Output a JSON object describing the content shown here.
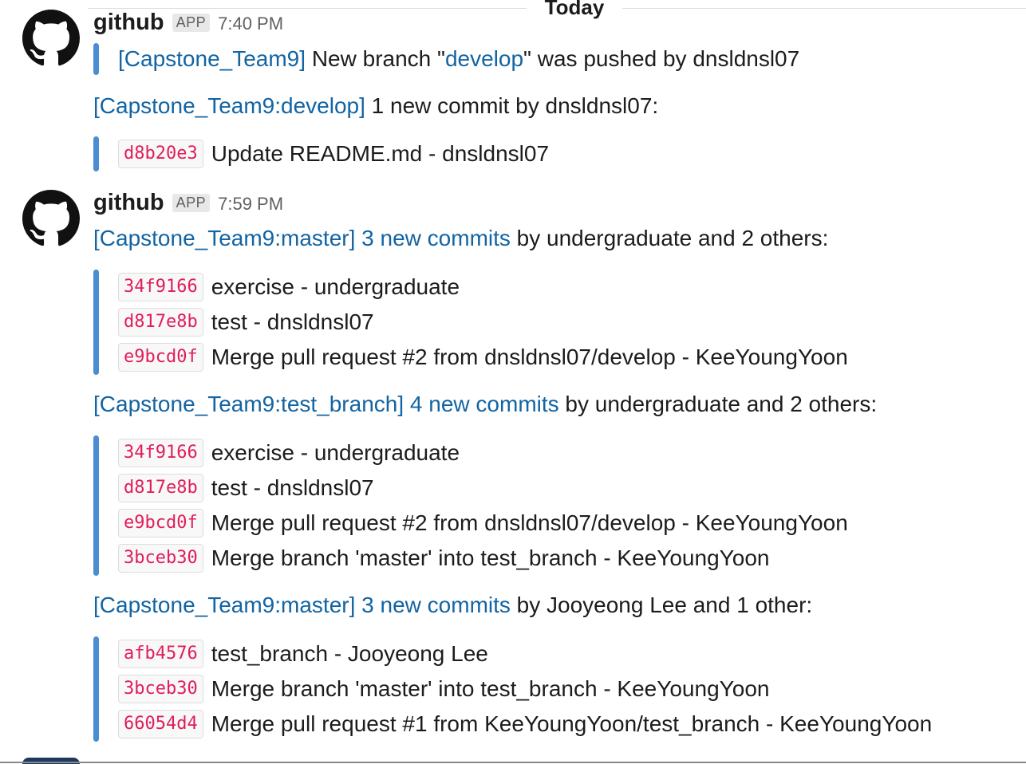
{
  "day_divider": "Today",
  "messages": [
    {
      "sender": "github",
      "badge": "APP",
      "time": "7:40 PM",
      "branch_notice": {
        "repo": "[Capstone_Team9]",
        "pre": " New branch \"",
        "branch": "develop",
        "post": "\" was pushed by dnsldnsl07"
      },
      "pushes": [
        {
          "ref": "[Capstone_Team9:develop]",
          "link_text": "",
          "rest": " 1 new commit by dnsldnsl07:",
          "commits": [
            {
              "hash": "d8b20e3",
              "text": "Update README.md - dnsldnsl07"
            }
          ]
        }
      ]
    },
    {
      "sender": "github",
      "badge": "APP",
      "time": "7:59 PM",
      "pushes": [
        {
          "ref": "[Capstone_Team9:master]",
          "link_text": "3 new commits",
          "rest": " by undergraduate and 2 others:",
          "commits": [
            {
              "hash": "34f9166",
              "text": "exercise - undergraduate"
            },
            {
              "hash": "d817e8b",
              "text": "test - dnsldnsl07"
            },
            {
              "hash": "e9bcd0f",
              "text": "Merge pull request #2 from dnsldnsl07/develop - KeeYoungYoon"
            }
          ]
        },
        {
          "ref": "[Capstone_Team9:test_branch]",
          "link_text": "4 new commits",
          "rest": " by undergraduate and 2 others:",
          "commits": [
            {
              "hash": "34f9166",
              "text": "exercise - undergraduate"
            },
            {
              "hash": "d817e8b",
              "text": "test - dnsldnsl07"
            },
            {
              "hash": "e9bcd0f",
              "text": "Merge pull request #2 from dnsldnsl07/develop - KeeYoungYoon"
            },
            {
              "hash": "3bceb30",
              "text": "Merge branch 'master' into test_branch - KeeYoungYoon"
            }
          ]
        },
        {
          "ref": "[Capstone_Team9:master]",
          "link_text": "3 new commits",
          "rest": " by Jooyeong Lee and 1 other:",
          "commits": [
            {
              "hash": "afb4576",
              "text": "test_branch - Jooyeong Lee"
            },
            {
              "hash": "3bceb30",
              "text": "Merge branch 'master' into test_branch - KeeYoungYoon"
            },
            {
              "hash": "66054d4",
              "text": "Merge pull request #1 from KeeYoungYoon/test_branch - KeeYoungYoon"
            }
          ]
        }
      ]
    }
  ],
  "icons": {
    "avatar": "github-octocat-icon"
  },
  "colors": {
    "link": "#1264a3",
    "hash": "#e01e5a",
    "quote_bar": "#4a8dd0"
  }
}
